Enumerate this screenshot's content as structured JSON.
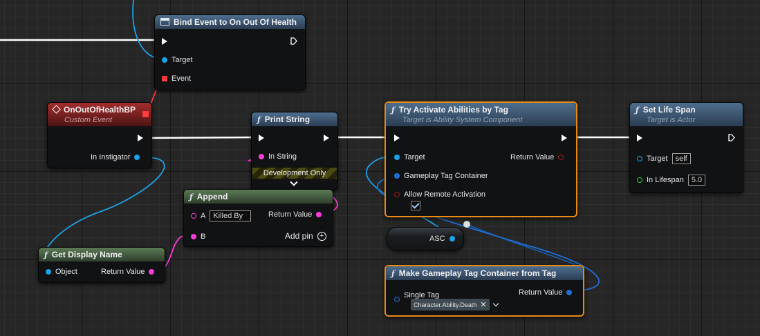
{
  "nodes": {
    "bind_event": {
      "title": "Bind Event to On Out Of Health",
      "pins": {
        "target": "Target",
        "event": "Event"
      }
    },
    "custom_event": {
      "title": "OnOutOfHealthBP",
      "subtitle": "Custom Event",
      "pins": {
        "in_instigator": "In Instigator"
      }
    },
    "print_string": {
      "title": "Print String",
      "pins": {
        "in_string": "In String"
      },
      "footer": "Development Only"
    },
    "try_activate": {
      "title": "Try Activate Abilities by Tag",
      "subtitle": "Target is Ability System Component",
      "pins": {
        "target": "Target",
        "gameplay_tag_container": "Gameplay Tag Container",
        "allow_remote": "Allow Remote Activation",
        "return_value": "Return Value"
      }
    },
    "set_life_span": {
      "title": "Set Life Span",
      "subtitle": "Target is Actor",
      "pins": {
        "target": "Target",
        "target_value": "self",
        "in_lifespan": "In Lifespan",
        "lifespan_value": "5.0"
      }
    },
    "append": {
      "title": "Append",
      "pins": {
        "a": "A",
        "a_value": "Killed By",
        "b": "B",
        "return_value": "Return Value",
        "add_pin": "Add pin"
      }
    },
    "get_display_name": {
      "title": "Get Display Name",
      "pins": {
        "object": "Object",
        "return_value": "Return Value"
      }
    },
    "asc": {
      "label": "ASC"
    },
    "make_tag_container": {
      "title": "Make Gameplay Tag Container from Tag",
      "pins": {
        "single_tag": "Single Tag",
        "tag_value": "Character.Ability.Death",
        "return_value": "Return Value"
      }
    }
  },
  "colors": {
    "exec": "#ffffff",
    "object": "#1aa3e8",
    "string": "#ff3ad9",
    "delegate": "#ff3b3b",
    "struct": "#1f6fd6",
    "bool": "#9a1b1b",
    "float": "#2fd12f",
    "selection": "#e88a14"
  },
  "icons": [
    "function-icon",
    "exec-pin-icon",
    "checkbox-icon",
    "add-pin-icon",
    "chevron-down-icon",
    "event-diamond-icon",
    "delegate-icon"
  ]
}
